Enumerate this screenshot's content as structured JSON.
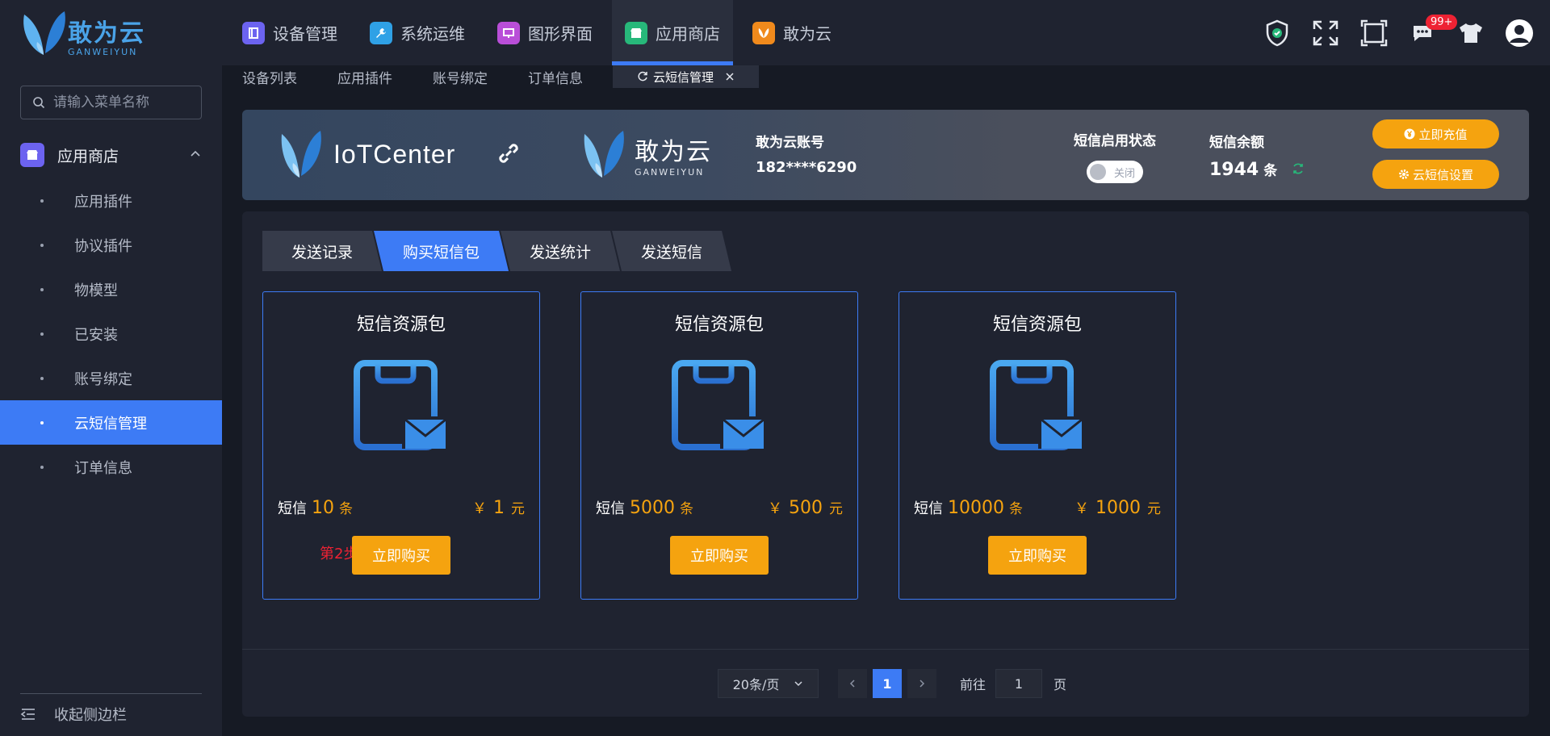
{
  "header": {
    "logo_cn": "敢为云",
    "logo_en": "GANWEIYUN",
    "nav": [
      {
        "label": "设备管理",
        "color": "#6c63f0"
      },
      {
        "label": "系统运维",
        "color": "#2fa1e6"
      },
      {
        "label": "图形界面",
        "color": "#b94ed8"
      },
      {
        "label": "应用商店",
        "color": "#27b87a"
      },
      {
        "label": "敢为云",
        "color": "#f08a1c"
      }
    ],
    "badge": "99+"
  },
  "sidebar": {
    "search_placeholder": "请输入菜单名称",
    "group_label": "应用商店",
    "items": [
      {
        "label": "应用插件"
      },
      {
        "label": "协议插件"
      },
      {
        "label": "物模型"
      },
      {
        "label": "已安装"
      },
      {
        "label": "账号绑定"
      },
      {
        "label": "云短信管理"
      },
      {
        "label": "订单信息"
      }
    ],
    "collapse_label": "收起侧边栏"
  },
  "tabs": [
    "设备列表",
    "应用插件",
    "账号绑定",
    "订单信息"
  ],
  "active_tab": "云短信管理",
  "banner": {
    "iot_text": "IoTCenter",
    "gw_cn": "敢为云",
    "gw_en": "GANWEIYUN",
    "account_label": "敢为云账号",
    "account_value": "182****6290",
    "status_label": "短信启用状态",
    "toggle_text": "关闭",
    "balance_label": "短信余额",
    "balance_value": "1944",
    "balance_unit": "条",
    "recharge_label": "立即充值",
    "settings_label": "云短信设置"
  },
  "sub_tabs": [
    "发送记录",
    "购买短信包",
    "发送统计",
    "发送短信"
  ],
  "cards": [
    {
      "title": "短信资源包",
      "sms_label": "短信",
      "count": "10",
      "count_unit": "条",
      "currency": "￥",
      "price": "1",
      "price_unit": "元",
      "button": "立即购买"
    },
    {
      "title": "短信资源包",
      "sms_label": "短信",
      "count": "5000",
      "count_unit": "条",
      "currency": "￥",
      "price": "500",
      "price_unit": "元",
      "button": "立即购买"
    },
    {
      "title": "短信资源包",
      "sms_label": "短信",
      "count": "10000",
      "count_unit": "条",
      "currency": "￥",
      "price": "1000",
      "price_unit": "元",
      "button": "立即购买"
    }
  ],
  "step_note": "第2步",
  "pager": {
    "page_size": "20条/页",
    "current_page": "1",
    "goto_label": "前往",
    "goto_value": "1",
    "page_label": "页"
  }
}
